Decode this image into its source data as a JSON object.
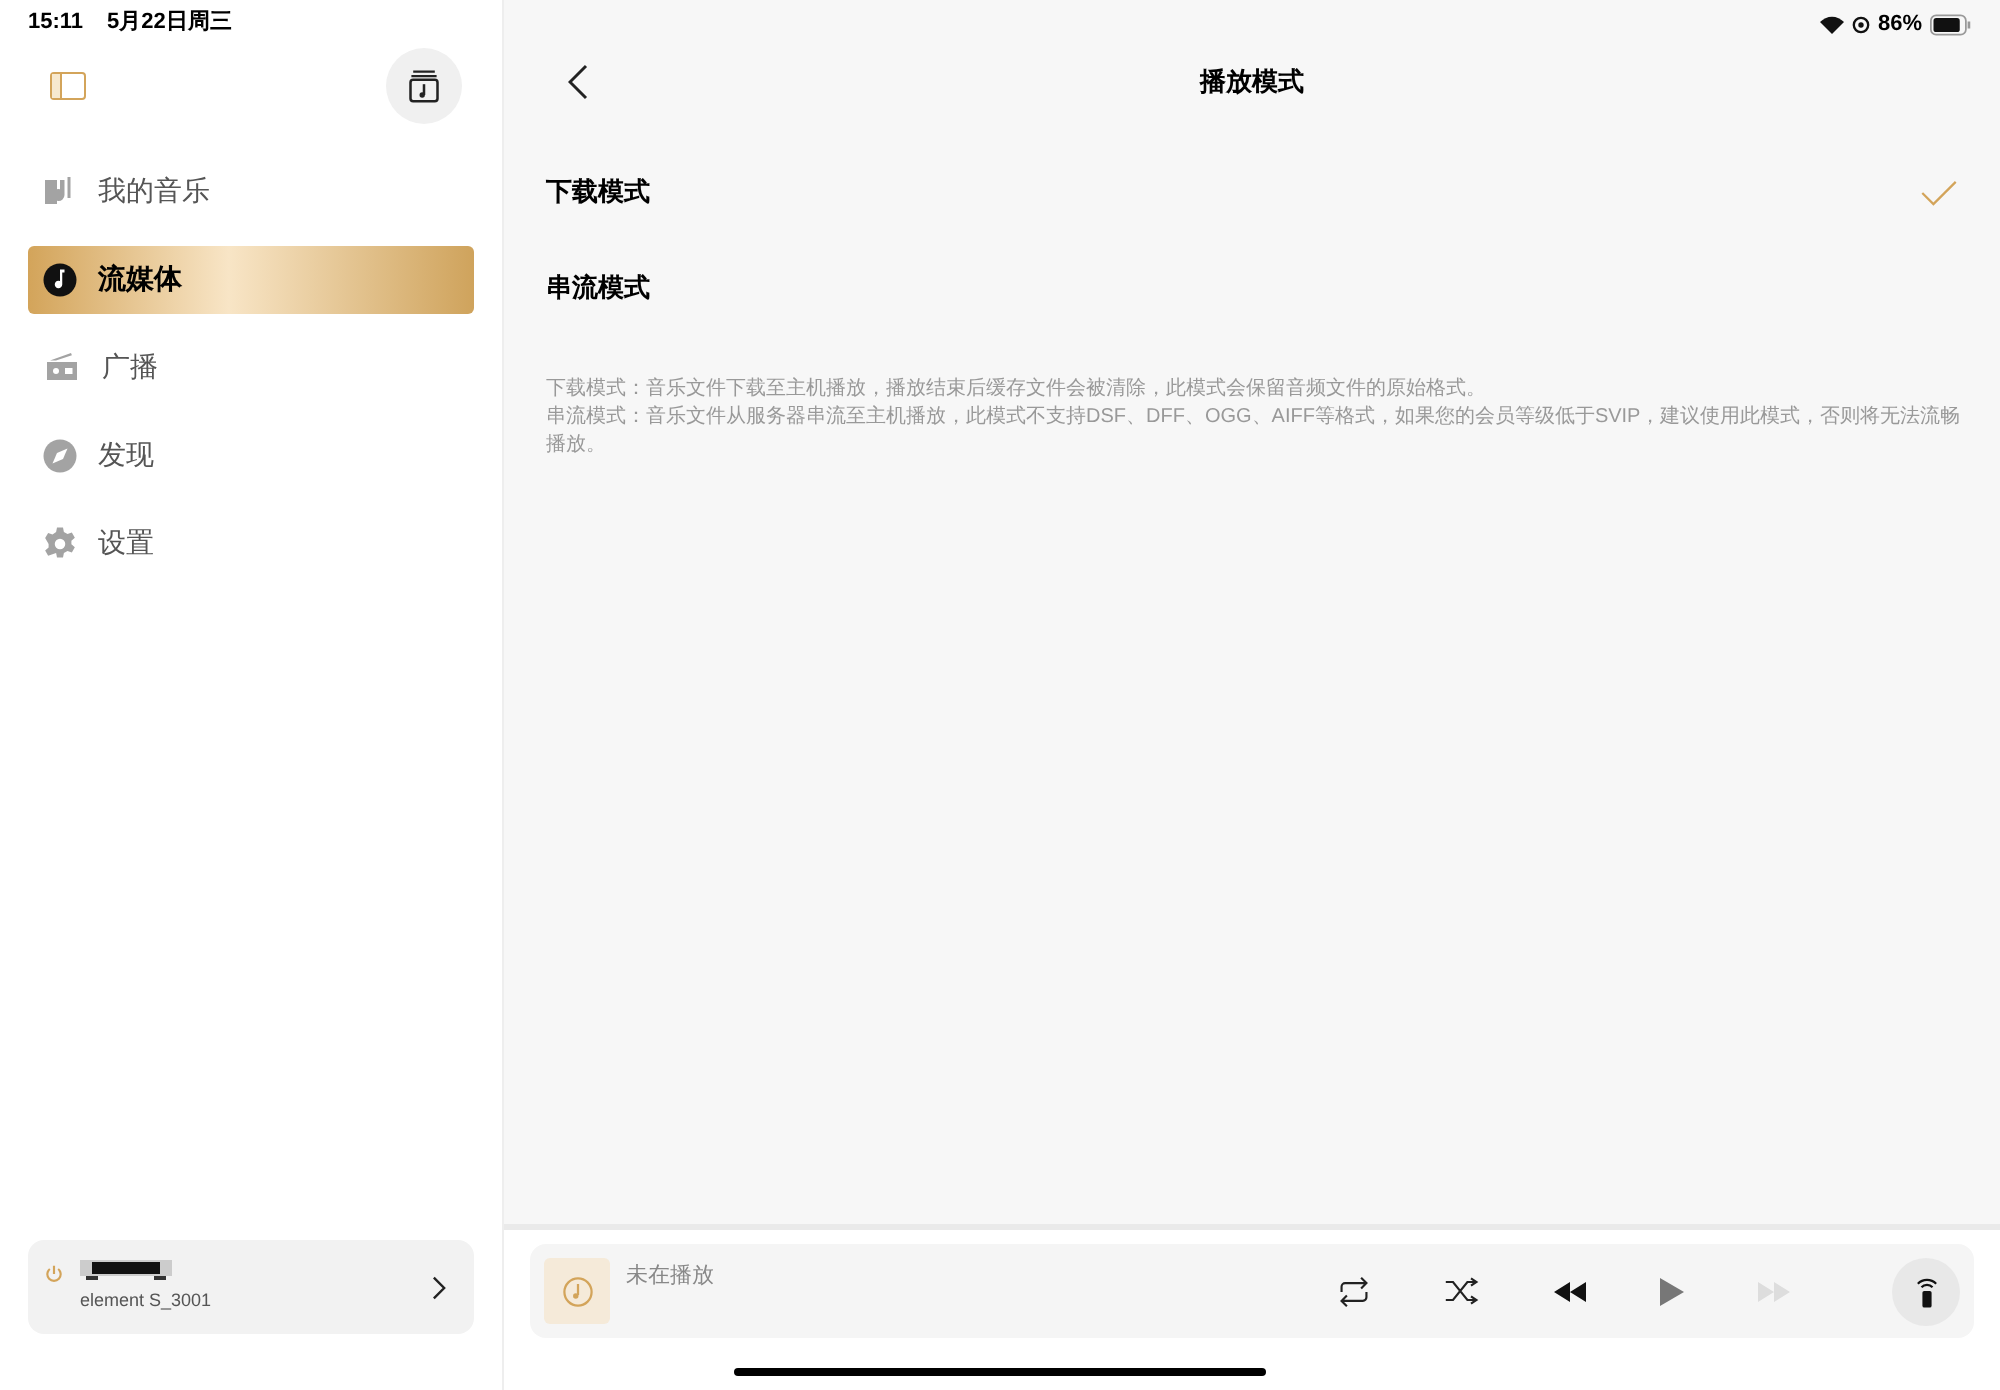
{
  "status_bar": {
    "time": "15:11",
    "date": "5月22日周三",
    "battery": "86%"
  },
  "sidebar": {
    "items": [
      {
        "label": "我的音乐",
        "selected": false
      },
      {
        "label": "流媒体",
        "selected": true
      },
      {
        "label": "广播",
        "selected": false
      },
      {
        "label": "发现",
        "selected": false
      },
      {
        "label": "设置",
        "selected": false
      }
    ],
    "device": {
      "name": "element S_3001"
    }
  },
  "page": {
    "title": "播放模式",
    "modes": [
      {
        "label": "下载模式",
        "selected": true
      },
      {
        "label": "串流模式",
        "selected": false
      }
    ],
    "notes": [
      "下载模式：音乐文件下载至主机播放，播放结束后缓存文件会被清除，此模式会保留音频文件的原始格式。",
      "串流模式：音乐文件从服务器串流至主机播放，此模式不支持DSF、DFF、OGG、AIFF等格式，如果您的会员等级低于SVIP，建议使用此模式，否则将无法流畅播放。"
    ]
  },
  "player": {
    "status": "未在播放",
    "next_disabled": true
  }
}
